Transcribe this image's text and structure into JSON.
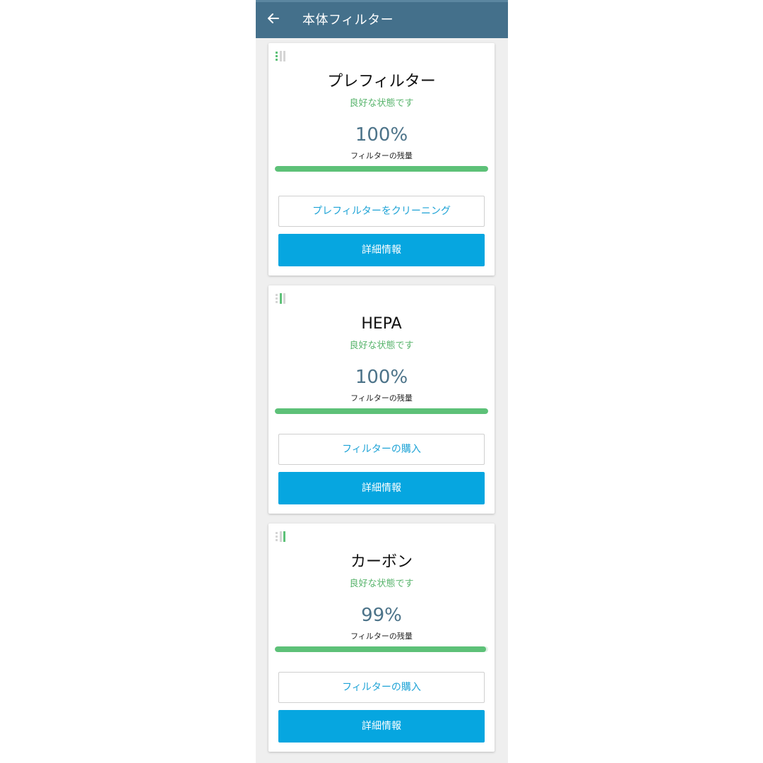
{
  "appbar": {
    "back_icon": "arrow-left-icon",
    "title": "本体フィルター"
  },
  "colors": {
    "appbar": "#44708b",
    "accent_blue": "#06a6e0",
    "status_green": "#58b46c",
    "bar_green": "#5dc178"
  },
  "filters": [
    {
      "level_icon": "filter-level-icon",
      "name": "プレフィルター",
      "status": "良好な状態です",
      "percent_text": "100%",
      "remaining": 1.0,
      "remaining_label": "フィルターの残量",
      "secondary_button": "プレフィルターをクリーニング",
      "primary_button": "詳細情報"
    },
    {
      "level_icon": "filter-level-icon",
      "name": "HEPA",
      "status": "良好な状態です",
      "percent_text": "100%",
      "remaining": 1.0,
      "remaining_label": "フィルターの残量",
      "secondary_button": "フィルターの購入",
      "primary_button": "詳細情報"
    },
    {
      "level_icon": "filter-level-icon",
      "name": "カーボン",
      "status": "良好な状態です",
      "percent_text": "99%",
      "remaining": 0.99,
      "remaining_label": "フィルターの残量",
      "secondary_button": "フィルターの購入",
      "primary_button": "詳細情報"
    }
  ]
}
